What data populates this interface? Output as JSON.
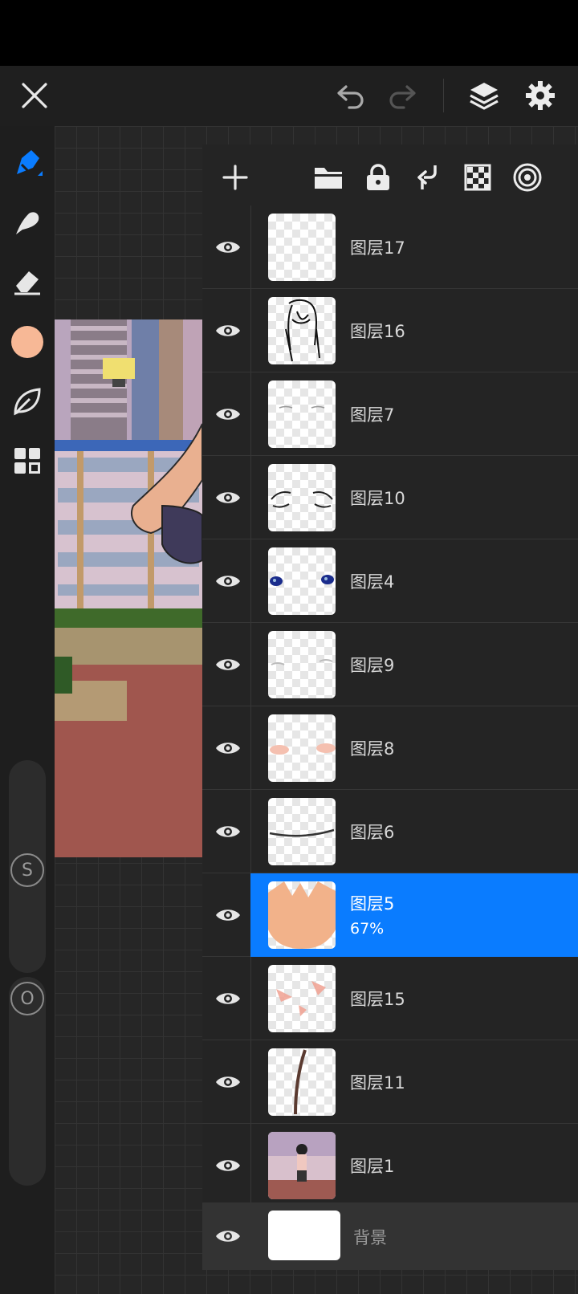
{
  "topbar": {
    "close": "close-icon",
    "undo": "undo-icon",
    "redo": "redo-icon",
    "layers": "layers-icon",
    "settings": "gear-icon"
  },
  "tools": [
    "pen-icon",
    "smudge-icon",
    "eraser-icon",
    "color-swatch",
    "leaf-icon",
    "grid-icon"
  ],
  "brush_color": "#f7b896",
  "sliders": {
    "size_label": "S",
    "opacity_label": "O"
  },
  "panel_toolbar": [
    "add-icon",
    "folder-icon",
    "lock-icon",
    "merge-down-icon",
    "transparency-icon",
    "target-icon"
  ],
  "layers": [
    {
      "name": "图层17"
    },
    {
      "name": "图层16"
    },
    {
      "name": "图层7"
    },
    {
      "name": "图层10"
    },
    {
      "name": "图层4"
    },
    {
      "name": "图层9"
    },
    {
      "name": "图层8"
    },
    {
      "name": "图层6"
    },
    {
      "name": "图层5",
      "opacity": "67%",
      "selected": true
    },
    {
      "name": "图层15"
    },
    {
      "name": "图层11"
    },
    {
      "name": "图层1"
    }
  ],
  "background_layer": {
    "name": "背景"
  },
  "colors": {
    "accent": "#0a7cff",
    "panel": "#242424",
    "rail": "#1e1e1e"
  }
}
